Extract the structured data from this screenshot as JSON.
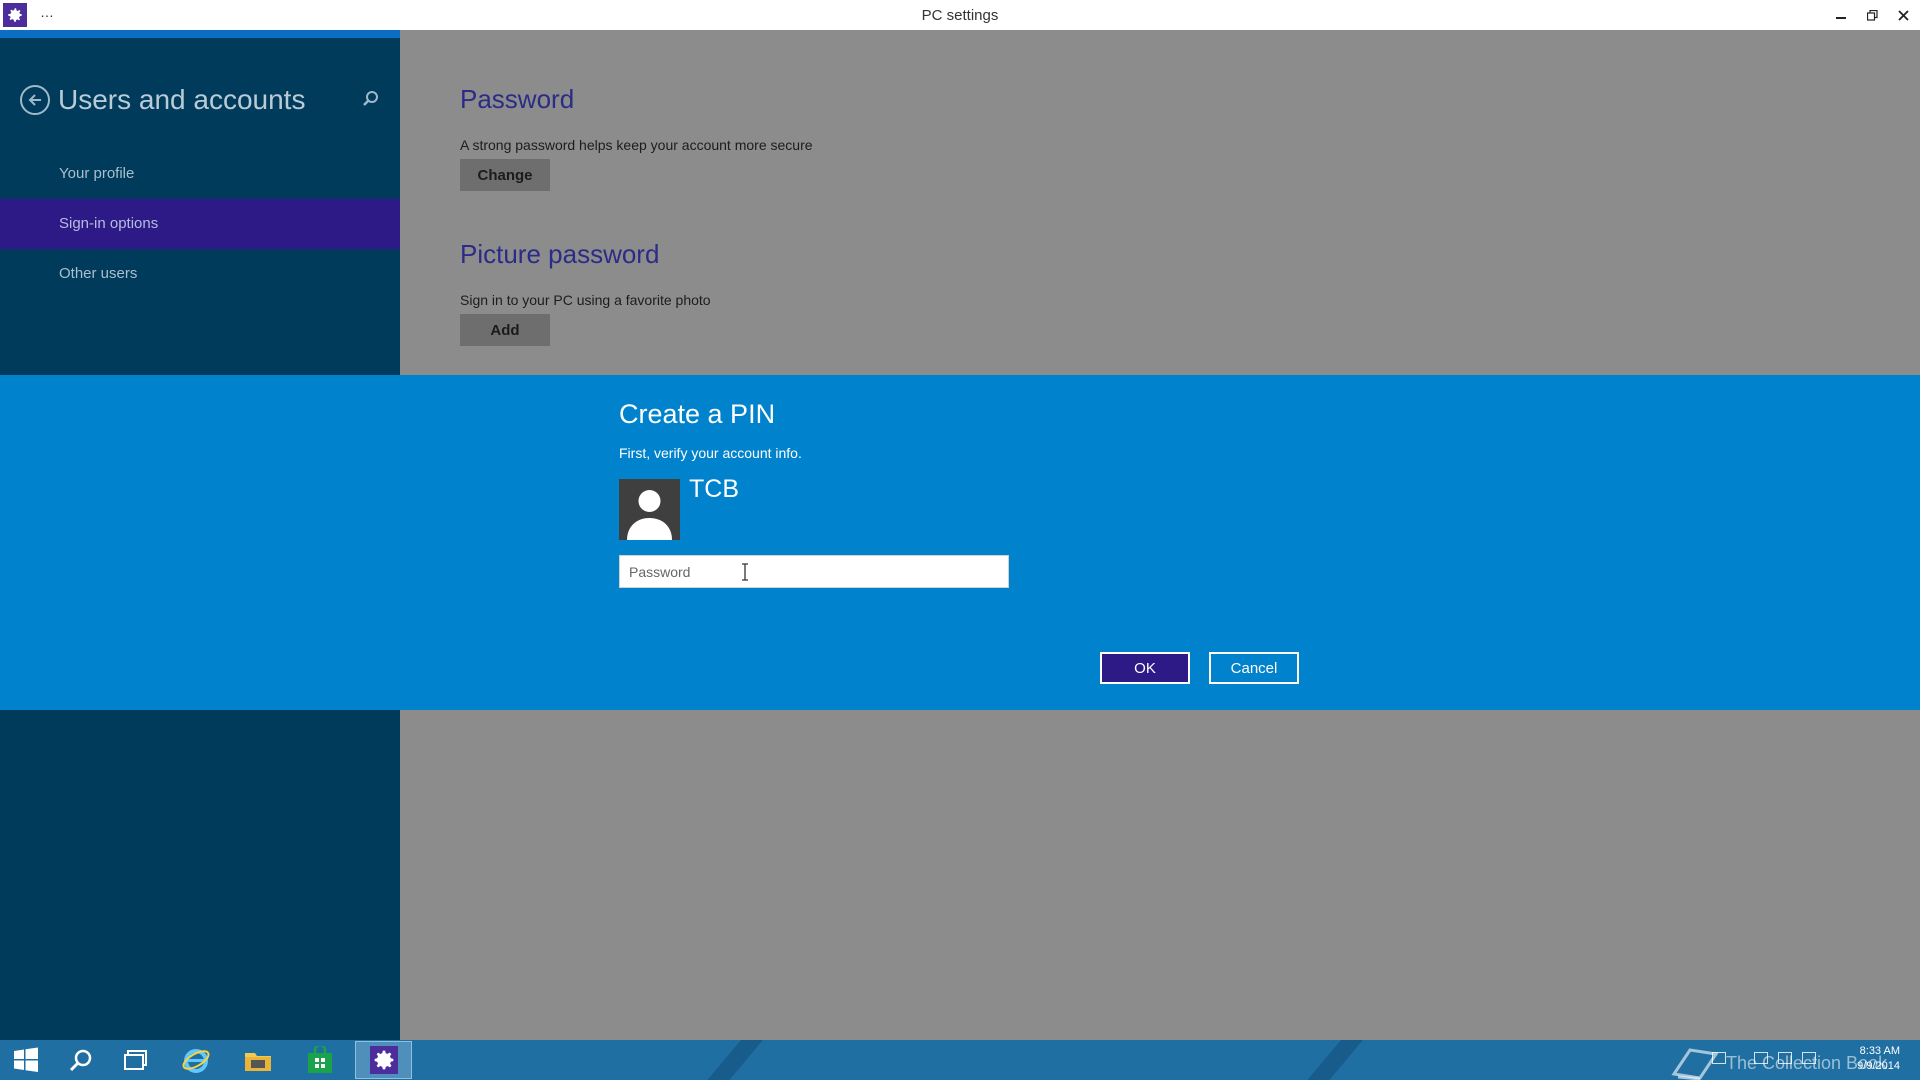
{
  "window": {
    "title": "PC settings",
    "menu_dots": "…"
  },
  "sidebar": {
    "title": "Users and accounts",
    "items": [
      {
        "label": "Your profile",
        "active": false
      },
      {
        "label": "Sign-in options",
        "active": true
      },
      {
        "label": "Other users",
        "active": false
      }
    ]
  },
  "main": {
    "password": {
      "title": "Password",
      "description": "A strong password helps keep your account more secure",
      "button_label": "Change"
    },
    "picture_password": {
      "title": "Picture password",
      "description": "Sign in to your PC using a favorite photo",
      "button_label": "Add"
    }
  },
  "dialog": {
    "title": "Create a PIN",
    "subtitle": "First, verify your account info.",
    "username": "TCB",
    "password_placeholder": "Password",
    "ok_label": "OK",
    "cancel_label": "Cancel"
  },
  "taskbar": {
    "watermark": "The Collection Book",
    "clock_time": "8:33 AM",
    "clock_date": "9/9/2014"
  },
  "colors": {
    "sidebar_bg": "#003b5c",
    "active_item": "#2e1a87",
    "dialog_bg": "#0083cc",
    "title_accent": "#2b2c86",
    "taskbar_bg": "#1f6fa3"
  }
}
